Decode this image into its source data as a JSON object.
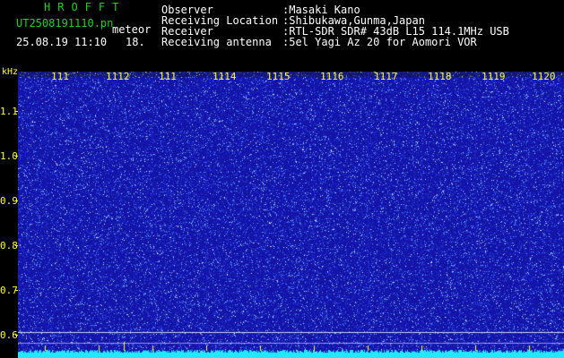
{
  "header": {
    "title": "HROFFT",
    "filename": "UT2508191110.pn",
    "type": "meteor",
    "datetime": "25.08.19 11:10",
    "counter": "18."
  },
  "info": [
    {
      "label": "Observer",
      "value": ":Masaki Kano"
    },
    {
      "label": "Receiving Location",
      "value": ":Shibukawa,Gunma,Japan"
    },
    {
      "label": "Receiver",
      "value": ":RTL-SDR SDR# 43dB L15 114.1MHz USB"
    },
    {
      "label": "Receiving antenna",
      "value": ":5el Yagi Az 20 for Aomori VOR"
    }
  ],
  "axis": {
    "y_unit": "kHz",
    "y_ticks": [
      "1.1",
      "1.0",
      "0.9",
      "0.8",
      "0.7",
      "0.6"
    ],
    "time_labels": [
      "1111",
      "1112",
      "1113",
      "1114",
      "1115",
      "1116",
      "1117",
      "1118",
      "1119",
      "1120"
    ]
  },
  "colors": {
    "background": "#000000",
    "spectro_base": "#1a1aa8",
    "noise_light": "#7fb0ff",
    "band_cyan": "#22e8ff",
    "axis_yellow": "#ffff22",
    "title_green": "#1fd11f"
  }
}
